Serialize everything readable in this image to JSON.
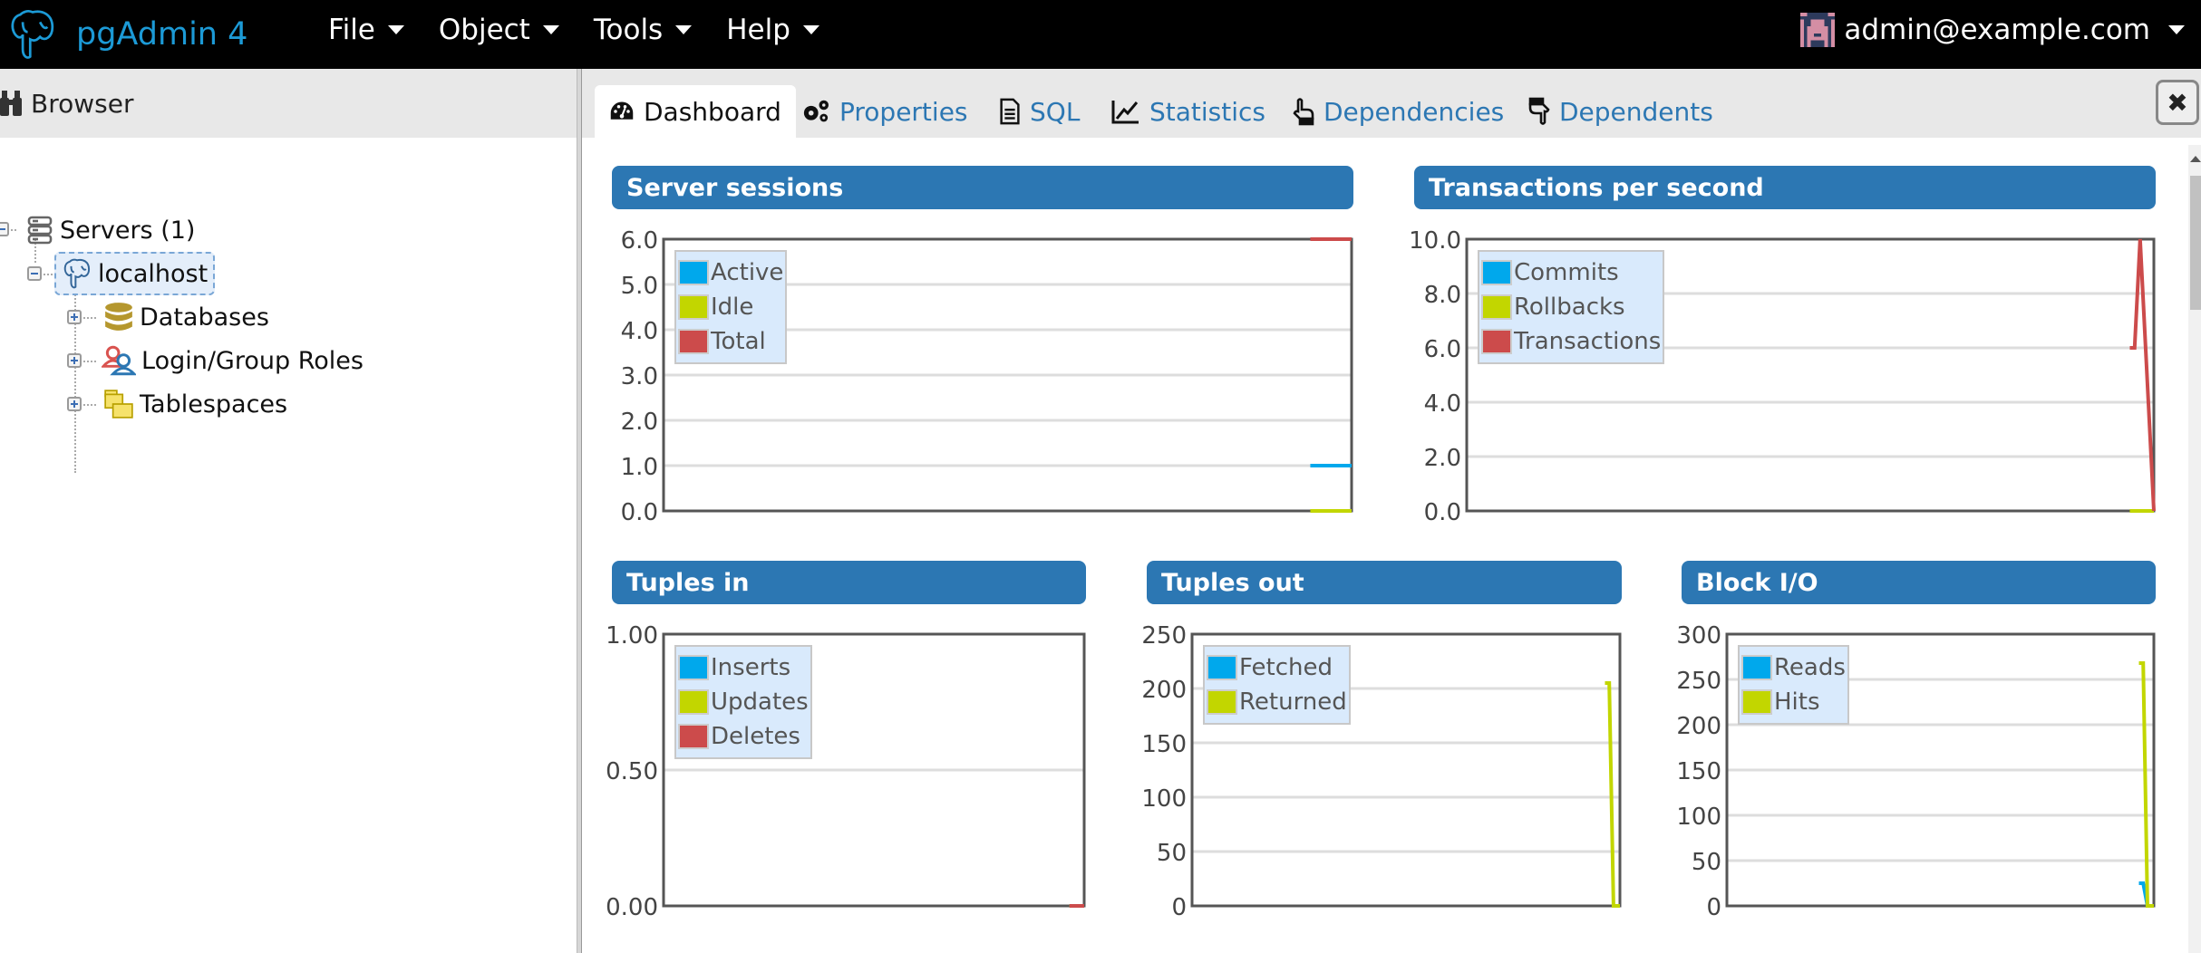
{
  "app": {
    "title": "pgAdmin 4",
    "brand_color": "#1c9ad6"
  },
  "menus": [
    {
      "label": "File"
    },
    {
      "label": "Object"
    },
    {
      "label": "Tools"
    },
    {
      "label": "Help"
    }
  ],
  "user": {
    "email": "admin@example.com"
  },
  "browser": {
    "title": "Browser",
    "tree": [
      {
        "label": "Servers (1)",
        "icon": "servers-icon",
        "level": 0
      },
      {
        "label": "localhost",
        "icon": "postgres-elephant-icon",
        "level": 1,
        "selected": true
      },
      {
        "label": "Databases",
        "icon": "database-icon",
        "level": 2
      },
      {
        "label": "Login/Group Roles",
        "icon": "roles-icon",
        "level": 2
      },
      {
        "label": "Tablespaces",
        "icon": "tablespaces-icon",
        "level": 2
      }
    ]
  },
  "tabs": [
    {
      "label": "Dashboard",
      "icon": "dashboard-icon",
      "active": true
    },
    {
      "label": "Properties",
      "icon": "gears-icon"
    },
    {
      "label": "SQL",
      "icon": "file-text-icon"
    },
    {
      "label": "Statistics",
      "icon": "line-chart-icon"
    },
    {
      "label": "Dependencies",
      "icon": "hand-up-icon"
    },
    {
      "label": "Dependents",
      "icon": "hand-down-icon"
    }
  ],
  "colors": {
    "blue": "#00a8ec",
    "green": "#c2d600",
    "red": "#cc4b4b",
    "header": "#2c77b3"
  },
  "chart_data": [
    {
      "type": "line",
      "title": "Server sessions",
      "ylim": [
        0,
        6
      ],
      "yticks": [
        "0.0",
        "1.0",
        "2.0",
        "3.0",
        "4.0",
        "5.0",
        "6.0"
      ],
      "ytick_values": [
        0,
        1,
        2,
        3,
        4,
        5,
        6
      ],
      "grid": true,
      "legend": "top-left",
      "x": [
        0.94,
        1.0
      ],
      "series": [
        {
          "name": "Active",
          "color": "#00a8ec",
          "values": [
            1,
            1
          ]
        },
        {
          "name": "Idle",
          "color": "#c2d600",
          "values": [
            0,
            0
          ]
        },
        {
          "name": "Total",
          "color": "#cc4b4b",
          "values": [
            6,
            6
          ]
        }
      ]
    },
    {
      "type": "line",
      "title": "Transactions per second",
      "ylim": [
        0,
        10
      ],
      "yticks": [
        "0.0",
        "2.0",
        "4.0",
        "6.0",
        "8.0",
        "10.0"
      ],
      "ytick_values": [
        0,
        2,
        4,
        6,
        8,
        10
      ],
      "grid": true,
      "legend": "top-left",
      "x": [
        0.965,
        0.972,
        0.98,
        1.0
      ],
      "series": [
        {
          "name": "Commits",
          "color": "#00a8ec",
          "values": [
            null,
            null,
            null,
            null
          ]
        },
        {
          "name": "Rollbacks",
          "color": "#c2d600",
          "values": [
            0,
            0,
            0,
            0
          ]
        },
        {
          "name": "Transactions",
          "color": "#cc4b4b",
          "values": [
            6,
            6,
            10,
            0
          ]
        }
      ]
    },
    {
      "type": "line",
      "title": "Tuples in",
      "ylim": [
        0,
        1
      ],
      "yticks": [
        "0.00",
        "0.50",
        "1.00"
      ],
      "ytick_values": [
        0,
        0.5,
        1
      ],
      "grid": true,
      "legend": "top-left",
      "x": [
        0.965,
        1.0
      ],
      "series": [
        {
          "name": "Inserts",
          "color": "#00a8ec",
          "values": [
            0,
            0
          ]
        },
        {
          "name": "Updates",
          "color": "#c2d600",
          "values": [
            0,
            0
          ]
        },
        {
          "name": "Deletes",
          "color": "#cc4b4b",
          "values": [
            0,
            0
          ]
        }
      ]
    },
    {
      "type": "line",
      "title": "Tuples out",
      "ylim": [
        0,
        250
      ],
      "yticks": [
        "0",
        "50",
        "100",
        "150",
        "200",
        "250"
      ],
      "ytick_values": [
        0,
        50,
        100,
        150,
        200,
        250
      ],
      "grid": true,
      "legend": "top-left",
      "x": [
        0.965,
        0.975,
        0.985,
        1.0
      ],
      "series": [
        {
          "name": "Fetched",
          "color": "#00a8ec",
          "values": [
            null,
            null,
            null,
            null
          ]
        },
        {
          "name": "Returned",
          "color": "#c2d600",
          "values": [
            205,
            205,
            0,
            0
          ]
        }
      ]
    },
    {
      "type": "line",
      "title": "Block I/O",
      "ylim": [
        0,
        300
      ],
      "yticks": [
        "0",
        "50",
        "100",
        "150",
        "200",
        "250",
        "300"
      ],
      "ytick_values": [
        0,
        50,
        100,
        150,
        200,
        250,
        300
      ],
      "grid": true,
      "legend": "top-left",
      "x": [
        0.965,
        0.975,
        0.985,
        1.0
      ],
      "series": [
        {
          "name": "Reads",
          "color": "#00a8ec",
          "values": [
            25,
            25,
            0,
            0
          ]
        },
        {
          "name": "Hits",
          "color": "#c2d600",
          "values": [
            268,
            268,
            0,
            0
          ]
        }
      ]
    }
  ]
}
